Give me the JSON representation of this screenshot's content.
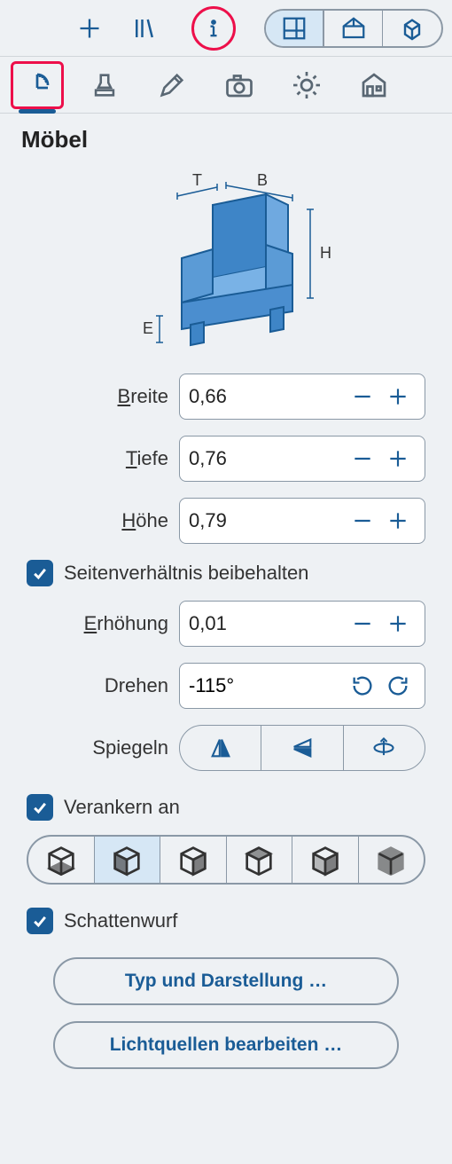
{
  "title": "Möbel",
  "diagram_labels": {
    "t": "T",
    "b": "B",
    "h": "H",
    "e": "E"
  },
  "fields": {
    "width": {
      "label_pre": "B",
      "label_rest": "reite",
      "value": "0,66"
    },
    "depth": {
      "label_pre": "T",
      "label_rest": "iefe",
      "value": "0,76"
    },
    "height": {
      "label_pre": "H",
      "label_rest": "öhe",
      "value": "0,79"
    },
    "raise": {
      "label_pre": "E",
      "label_rest": "rhöhung",
      "value": "0,01"
    },
    "rotate": {
      "label": "Drehen",
      "value": "-115°"
    },
    "mirror": {
      "label": "Spiegeln"
    }
  },
  "checks": {
    "aspect": "Seitenverhältnis beibehalten",
    "anchor": "Verankern an",
    "shadow": "Schattenwurf"
  },
  "buttons": {
    "type": "Typ und Darstellung …",
    "lights": "Lichtquellen bearbeiten …"
  }
}
